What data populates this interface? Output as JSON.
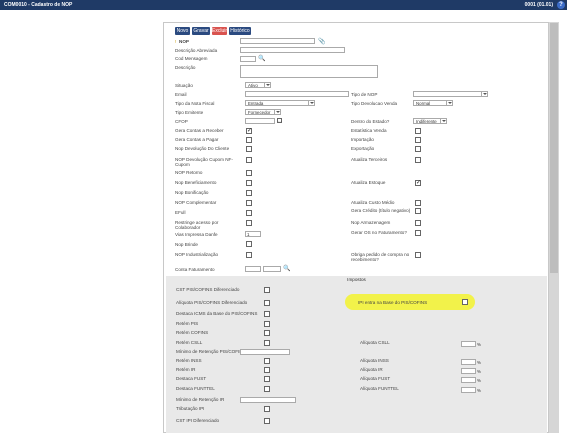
{
  "window": {
    "title": "COM0010 - Cadastro de NOP",
    "right": "0001 (01.01)"
  },
  "toolbar": {
    "new_label": "Novo",
    "save_label": "Gravar",
    "delete_label": "Excluir",
    "history_label": "Histórico"
  },
  "form": {
    "nop_label": "NOP",
    "descricao_label": "Descrição Abreviada",
    "mensagem_label": "Cod Mensagem",
    "descricao_full_label": "Descrição",
    "situacao_label": "Situação",
    "situacao_value": "Ativo",
    "email_label": "Email",
    "tipo_nop_label": "Tipo de NOP",
    "tipo_nota_label": "Tipo da Nota Fiscal",
    "tipo_nota_value": "Entrada",
    "tipo_devolucao_label": "Tipo Devolucao Venda",
    "tipo_devolucao_value": "Normal",
    "tipo_emitente_label": "Tipo Emitente",
    "tipo_emitente_value": "Fornecedor",
    "cfop_label": "CFOP",
    "dentro_estado_label": "Dentro do Estado?",
    "dentro_estado_value": "Indiferente",
    "left_checks": [
      {
        "label": "Gera Contas a Receber",
        "checked": true
      },
      {
        "label": "Gera Contas a Pagar",
        "checked": false
      },
      {
        "label": "Nop Devolução Do Cliente",
        "checked": false
      },
      {
        "label": "NOP Devolução Cupom NF-Cupom",
        "checked": false
      },
      {
        "label": "NOP Retorno",
        "checked": false
      },
      {
        "label": "Nop Beneficiamento",
        "checked": false
      },
      {
        "label": "Nop Bonificação",
        "checked": false
      },
      {
        "label": "NOP Complementar",
        "checked": false
      },
      {
        "label": "EFull",
        "checked": false
      },
      {
        "label": "Restringe acesso por Colaborador",
        "checked": false
      }
    ],
    "right_checks": [
      {
        "label": "Estatística Venda",
        "checked": false
      },
      {
        "label": "Importação",
        "checked": false
      },
      {
        "label": "Exportação",
        "checked": false
      },
      {
        "label": "Atualiza Terceiros",
        "checked": false
      },
      {
        "label": "Atualiza Estoque",
        "checked": true
      },
      {
        "label": "Atualiza Custo Médio",
        "checked": false
      },
      {
        "label": "Gera Crédito (título negativo)",
        "checked": false
      },
      {
        "label": "Nop Armazenagem",
        "checked": false
      },
      {
        "label": "Gerar OS no Faturamento?",
        "checked": false
      },
      {
        "label": "Obriga pedido de compra no recebimento?",
        "checked": false
      }
    ],
    "vias_label": "Vias Impressa Danfe",
    "vias_value": "1",
    "nop_brinde_label": "Nop Brinde",
    "nop_industrializacao_label": "NOP Industrialização",
    "conta_faturamento_label": "Conta Faturamento"
  },
  "impostos": {
    "title": "Impostos",
    "left": [
      "CST PIS/COFINS Diferenciado",
      "Alíquota PIS/COFINS Diferenciado",
      "Destaca ICMS da Base do PIS/COFINS",
      "Retém PIS",
      "Retém COFINS",
      "Retém CSLL",
      "Mínimo de Retenção PIS/COFINS/CSLL",
      "Retém INSS",
      "Retém IR",
      "Destaca FUST",
      "Destaca FUNTTEL",
      "Mínimo de Retenção IR",
      "Tributação IPI",
      "CST IPI Diferenciado"
    ],
    "ipi_base_label": "IPI entra na Base do PIS/COFINS",
    "aliquotas": [
      "Alíquota CSLL",
      "Alíquota INSS",
      "Alíquota IR",
      "Alíquota FUST",
      "Alíquota FUNTTEL"
    ],
    "percent": "%"
  },
  "colors": {
    "titlebar": "#1f3a66",
    "button": "#2b4a80",
    "delete": "#d9534f",
    "highlight": "#f2f24a"
  }
}
